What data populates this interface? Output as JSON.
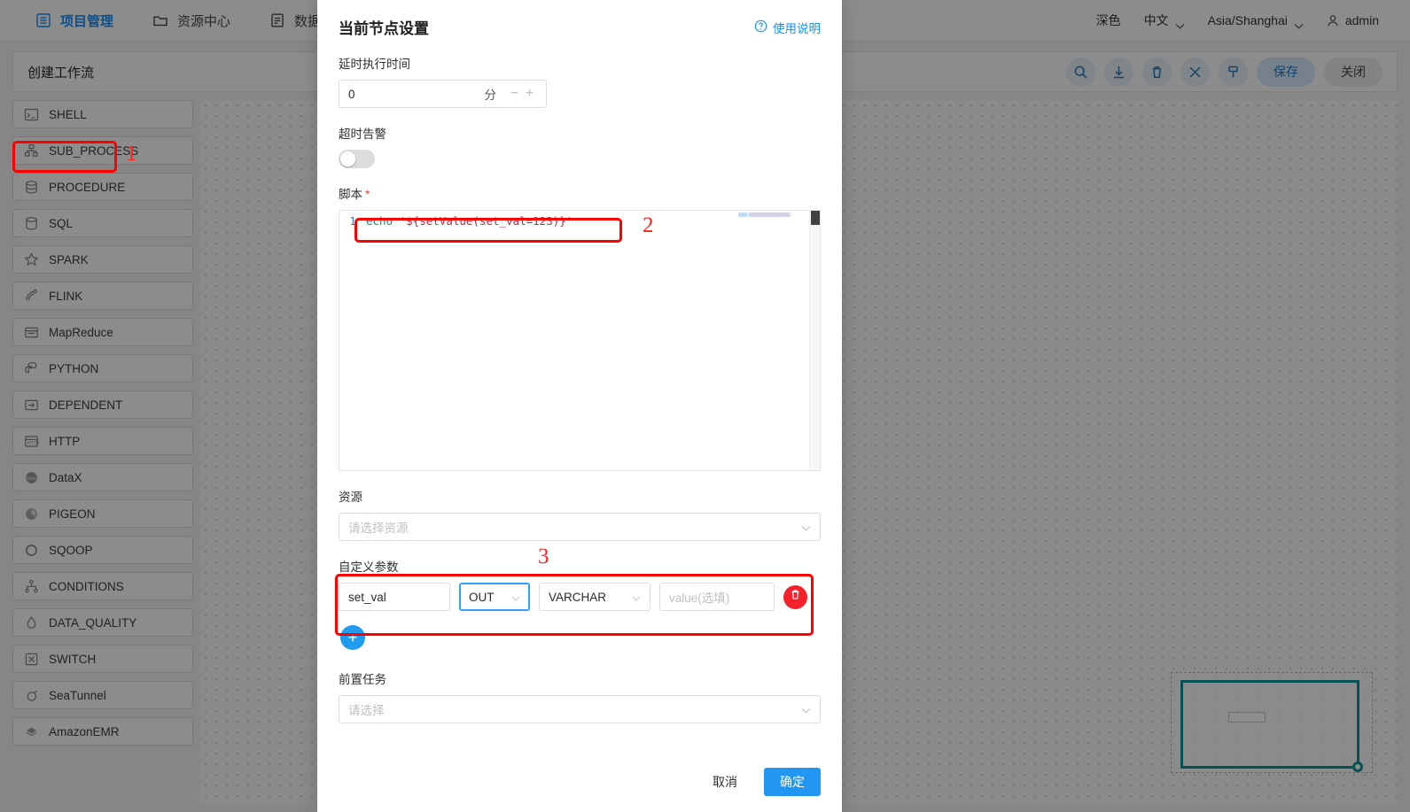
{
  "topnav": {
    "items": [
      {
        "label": "项目管理",
        "icon": "project-icon",
        "active": true
      },
      {
        "label": "资源中心",
        "icon": "folder-icon",
        "active": false
      },
      {
        "label": "数据质量",
        "icon": "data-quality-icon",
        "active": false
      }
    ],
    "right": {
      "theme": "深色",
      "language": "中文",
      "timezone": "Asia/Shanghai",
      "user": "admin"
    }
  },
  "workflow": {
    "title": "创建工作流",
    "tools": [
      {
        "name": "search-icon"
      },
      {
        "name": "download-icon"
      },
      {
        "name": "delete-icon"
      },
      {
        "name": "fullscreen-icon"
      },
      {
        "name": "format-icon"
      }
    ],
    "save_label": "保存",
    "close_label": "关闭"
  },
  "palette": {
    "items": [
      {
        "label": "SHELL",
        "icon": "shell-icon"
      },
      {
        "label": "SUB_PROCESS",
        "icon": "subprocess-icon"
      },
      {
        "label": "PROCEDURE",
        "icon": "procedure-icon"
      },
      {
        "label": "SQL",
        "icon": "sql-icon"
      },
      {
        "label": "SPARK",
        "icon": "spark-icon"
      },
      {
        "label": "FLINK",
        "icon": "flink-icon"
      },
      {
        "label": "MapReduce",
        "icon": "mapreduce-icon"
      },
      {
        "label": "PYTHON",
        "icon": "python-icon"
      },
      {
        "label": "DEPENDENT",
        "icon": "dependent-icon"
      },
      {
        "label": "HTTP",
        "icon": "http-icon"
      },
      {
        "label": "DataX",
        "icon": "datax-icon"
      },
      {
        "label": "PIGEON",
        "icon": "pigeon-icon"
      },
      {
        "label": "SQOOP",
        "icon": "sqoop-icon"
      },
      {
        "label": "CONDITIONS",
        "icon": "conditions-icon"
      },
      {
        "label": "DATA_QUALITY",
        "icon": "dataquality-icon"
      },
      {
        "label": "SWITCH",
        "icon": "switch-icon"
      },
      {
        "label": "SeaTunnel",
        "icon": "seatunnel-icon"
      },
      {
        "label": "AmazonEMR",
        "icon": "amazonemr-icon"
      }
    ]
  },
  "modal": {
    "title": "当前节点设置",
    "help_label": "使用说明",
    "delay": {
      "label": "延时执行时间",
      "value": "0",
      "unit": "分",
      "minus": "−",
      "plus": "+"
    },
    "timeout": {
      "label": "超时告警",
      "enabled": false
    },
    "script": {
      "label": "脚本",
      "required": "*",
      "line_number": "1",
      "code_command": "echo",
      "code_string": "'${setValue(set_val=123)}'"
    },
    "resource": {
      "label": "资源",
      "placeholder": "请选择资源",
      "value": ""
    },
    "custom_params": {
      "label": "自定义参数",
      "rows": [
        {
          "name": "set_val",
          "direction": "OUT",
          "type": "VARCHAR",
          "value_placeholder": "value(选填)",
          "value": ""
        }
      ],
      "add_label": "+",
      "delete_icon": "trash-icon"
    },
    "pre_tasks": {
      "label": "前置任务",
      "placeholder": "请选择",
      "value": ""
    },
    "cancel_label": "取消",
    "confirm_label": "确定"
  },
  "annotations": [
    {
      "number": "1",
      "target": "shell-task-item"
    },
    {
      "number": "2",
      "target": "script-code-line"
    },
    {
      "number": "3",
      "target": "custom-params-block"
    }
  ],
  "colors": {
    "accent": "#1890ff",
    "primary_button": "#2196f3",
    "annotation": "#ff0000",
    "danger": "#f5222d",
    "minimap_viewport": "#0a9396"
  }
}
